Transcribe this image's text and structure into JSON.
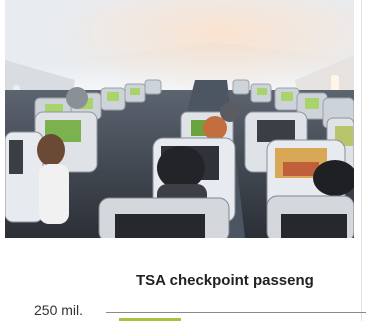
{
  "photo": {
    "alt": "Airplane cabin interior with passengers and seatback screens"
  },
  "chart": {
    "title": "TSA checkpoint passeng",
    "y_tick": "250 mil.",
    "bar_color": "#a9c23f"
  }
}
